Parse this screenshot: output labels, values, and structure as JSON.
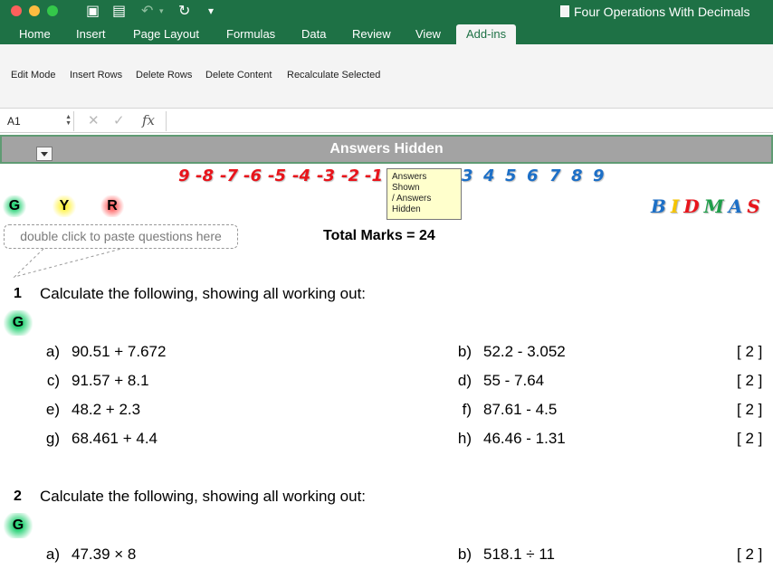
{
  "window": {
    "title": "Four Operations With Decimals"
  },
  "tabs": [
    "Home",
    "Insert",
    "Page Layout",
    "Formulas",
    "Data",
    "Review",
    "View",
    "Add-ins"
  ],
  "active_tab": "Add-ins",
  "ribbon": [
    "Edit Mode",
    "Insert Rows",
    "Delete Rows",
    "Delete Content",
    "Recalculate Selected"
  ],
  "formula_bar": {
    "cell_ref": "A1",
    "fx": "fx"
  },
  "header": {
    "title": "Answers Hidden"
  },
  "number_line": {
    "negatives": [
      "9",
      "-8",
      "-7",
      "-6",
      "-5",
      "-4",
      "-3",
      "-2",
      "-1"
    ],
    "positives": [
      "3",
      "4",
      "5",
      "6",
      "7",
      "8",
      "9"
    ]
  },
  "tooltip": {
    "line1": "Answers Shown",
    "line2": "/ Answers",
    "line3": "Hidden"
  },
  "gyr": {
    "g": "G",
    "y": "Y",
    "r": "R"
  },
  "bidmas": {
    "letters": [
      "B",
      "I",
      "D",
      "M",
      "A",
      "S"
    ],
    "colors": [
      "#1c6fc7",
      "#f5c400",
      "#e8141b",
      "#1e9e4a",
      "#1c6fc7",
      "#e8141b"
    ]
  },
  "paste_hint": "double click to paste questions here",
  "total_marks": "Total Marks = 24",
  "questions": [
    {
      "number": "1",
      "text": "Calculate the following, showing all working out:",
      "badge": "G",
      "parts": [
        {
          "label": "a)",
          "expr": "90.51 + 7.672"
        },
        {
          "label": "b)",
          "expr": "52.2 - 3.052",
          "marks": "[ 2 ]"
        },
        {
          "label": "c)",
          "expr": "91.57 + 8.1"
        },
        {
          "label": "d)",
          "expr": "55 - 7.64",
          "marks": "[ 2 ]"
        },
        {
          "label": "e)",
          "expr": "48.2 + 2.3"
        },
        {
          "label": "f)",
          "expr": "87.61 - 4.5",
          "marks": "[ 2 ]"
        },
        {
          "label": "g)",
          "expr": "68.461 + 4.4"
        },
        {
          "label": "h)",
          "expr": "46.46 - 1.31",
          "marks": "[ 2 ]"
        }
      ]
    },
    {
      "number": "2",
      "text": "Calculate the following, showing all working out:",
      "badge": "G",
      "parts": [
        {
          "label": "a)",
          "expr": "47.39 × 8"
        },
        {
          "label": "b)",
          "expr": "518.1 ÷ 11",
          "marks": "[ 2 ]"
        }
      ]
    }
  ]
}
